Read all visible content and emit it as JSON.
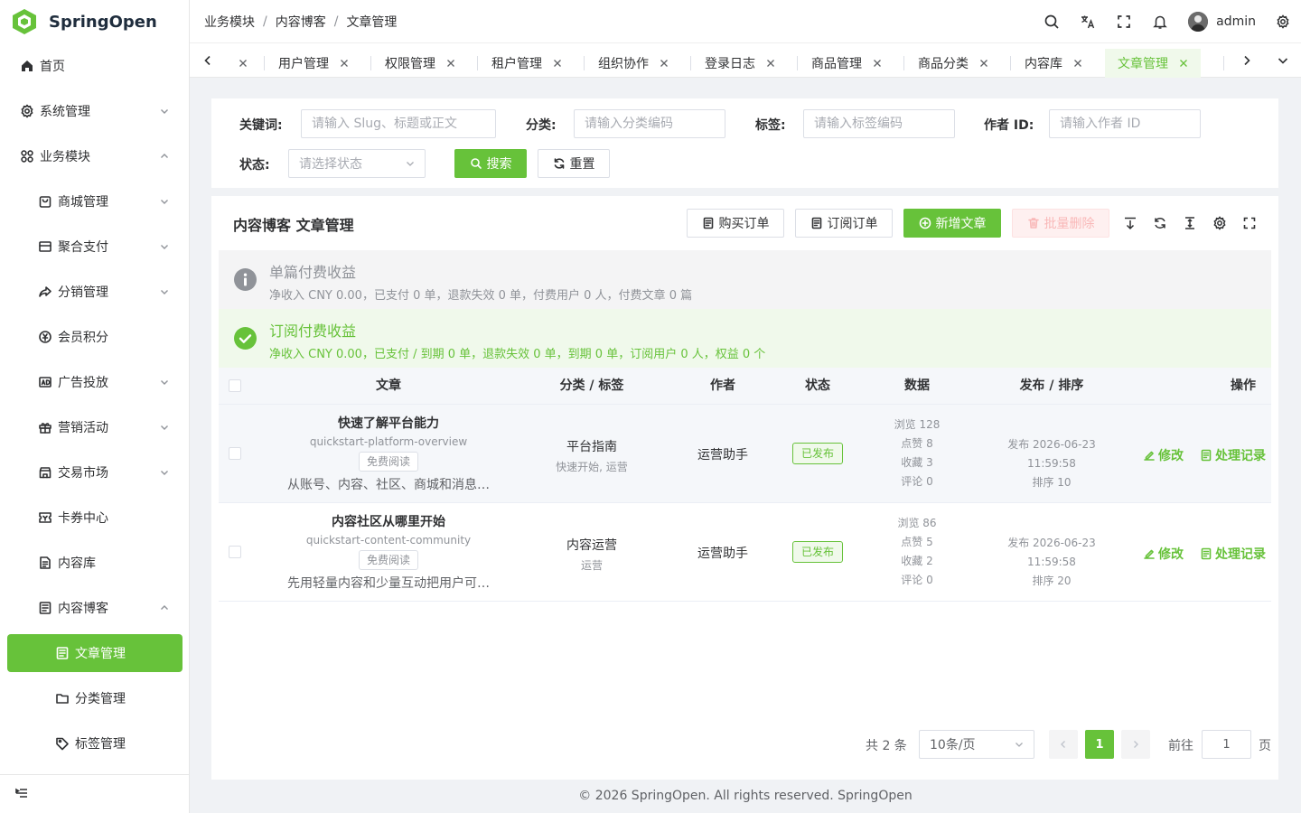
{
  "app": {
    "name": "SpringOpen"
  },
  "sidebar": {
    "items": [
      {
        "label": "首页",
        "icon": "home-icon"
      },
      {
        "label": "系统管理",
        "icon": "gear-icon"
      },
      {
        "label": "业务模块",
        "icon": "grid-icon"
      },
      {
        "label": "商城管理",
        "icon": "shop-icon"
      },
      {
        "label": "聚合支付",
        "icon": "card-icon"
      },
      {
        "label": "分销管理",
        "icon": "share-icon"
      },
      {
        "label": "会员积分",
        "icon": "coin-icon"
      },
      {
        "label": "广告投放",
        "icon": "ad-icon"
      },
      {
        "label": "营销活动",
        "icon": "gift-icon"
      },
      {
        "label": "交易市场",
        "icon": "market-icon"
      },
      {
        "label": "卡券中心",
        "icon": "coupon-icon"
      },
      {
        "label": "内容库",
        "icon": "document-icon"
      },
      {
        "label": "内容博客",
        "icon": "blog-icon"
      },
      {
        "label": "文章管理",
        "icon": "article-icon"
      },
      {
        "label": "分类管理",
        "icon": "folder-icon"
      },
      {
        "label": "标签管理",
        "icon": "tag-icon"
      }
    ]
  },
  "header": {
    "breadcrumb": [
      "业务模块",
      "内容博客",
      "文章管理"
    ],
    "separator": "/",
    "username": "admin"
  },
  "tabs": [
    "用户管理",
    "权限管理",
    "租户管理",
    "组织协作",
    "登录日志",
    "商品管理",
    "商品分类",
    "内容库",
    "文章管理"
  ],
  "search": {
    "keyword_label": "关键词:",
    "keyword_placeholder": "请输入 Slug、标题或正文",
    "category_label": "分类:",
    "category_placeholder": "请输入分类编码",
    "tag_label": "标签:",
    "tag_placeholder": "请输入标签编码",
    "author_label": "作者 ID:",
    "author_placeholder": "请输入作者 ID",
    "status_label": "状态:",
    "status_placeholder": "请选择状态",
    "search_btn": "搜索",
    "reset_btn": "重置"
  },
  "card": {
    "title": "内容博客 文章管理",
    "buy_orders": "购买订单",
    "sub_orders": "订阅订单",
    "add_article": "新增文章",
    "batch_delete": "批量删除"
  },
  "alerts": {
    "single": {
      "title": "单篇付费收益",
      "desc": "净收入 CNY 0.00，已支付 0 单，退款失效 0 单，付费用户 0 人，付费文章 0 篇"
    },
    "subscription": {
      "title": "订阅付费收益",
      "desc": "净收入 CNY 0.00，已支付 / 到期 0 单，退款失效 0 单，到期 0 单，订阅用户 0 人，权益 0 个"
    }
  },
  "table": {
    "columns": [
      "文章",
      "分类 / 标签",
      "作者",
      "状态",
      "数据",
      "发布 / 排序",
      "操作"
    ],
    "rows": [
      {
        "title": "快速了解平台能力",
        "slug": "quickstart-platform-overview",
        "access": "免费阅读",
        "excerpt": "从账号、内容、社区、商城和消息…",
        "category": "平台指南",
        "tags": "快速开始, 运营",
        "author": "运营助手",
        "status": "已发布",
        "views": "浏览 128",
        "likes": "点赞 8",
        "favorites": "收藏 3",
        "comments": "评论 0",
        "published": "发布 2026-06-23 11:59:58",
        "sort": "排序 10",
        "edit": "修改",
        "records": "处理记录"
      },
      {
        "title": "内容社区从哪里开始",
        "slug": "quickstart-content-community",
        "access": "免费阅读",
        "excerpt": "先用轻量内容和少量互动把用户可…",
        "category": "内容运营",
        "tags": "运营",
        "author": "运营助手",
        "status": "已发布",
        "views": "浏览 86",
        "likes": "点赞 5",
        "favorites": "收藏 2",
        "comments": "评论 0",
        "published": "发布 2026-06-23 11:59:58",
        "sort": "排序 20",
        "edit": "修改",
        "records": "处理记录"
      }
    ]
  },
  "pagination": {
    "total": "共 2 条",
    "page_size": "10条/页",
    "current": "1",
    "goto_label": "前往",
    "goto_value": "1",
    "page_suffix": "页"
  },
  "footer": "© 2026 SpringOpen. All rights reserved. SpringOpen",
  "colors": {
    "accent": "#67c23a",
    "danger_light": "#fef0f0"
  }
}
